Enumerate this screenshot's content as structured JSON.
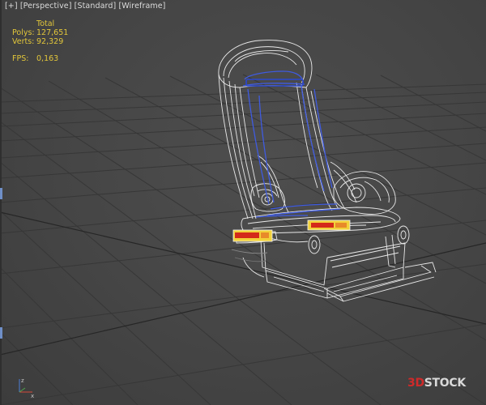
{
  "viewport": {
    "label_plus": "[+]",
    "label_view": "[Perspective]",
    "label_shading": "[Standard]",
    "label_mode": "[Wireframe]"
  },
  "stats": {
    "header": "Total",
    "polys_label": "Polys:",
    "polys_value": "127,651",
    "verts_label": "Verts:",
    "verts_value": "92,329",
    "fps_label": "FPS:",
    "fps_value": "0,163"
  },
  "axis": {
    "z_label": "z",
    "x_label": "x"
  },
  "watermark": {
    "number": "3D",
    "text": "STOCK"
  },
  "colors": {
    "background": "#454545",
    "grid": "#3a3a3a",
    "wire_white": "#eeeeee",
    "wire_blue": "#3f5be0",
    "stats_text": "#e2c63a",
    "handle_red": "#d42a1a",
    "handle_yellow": "#f2d23a"
  }
}
